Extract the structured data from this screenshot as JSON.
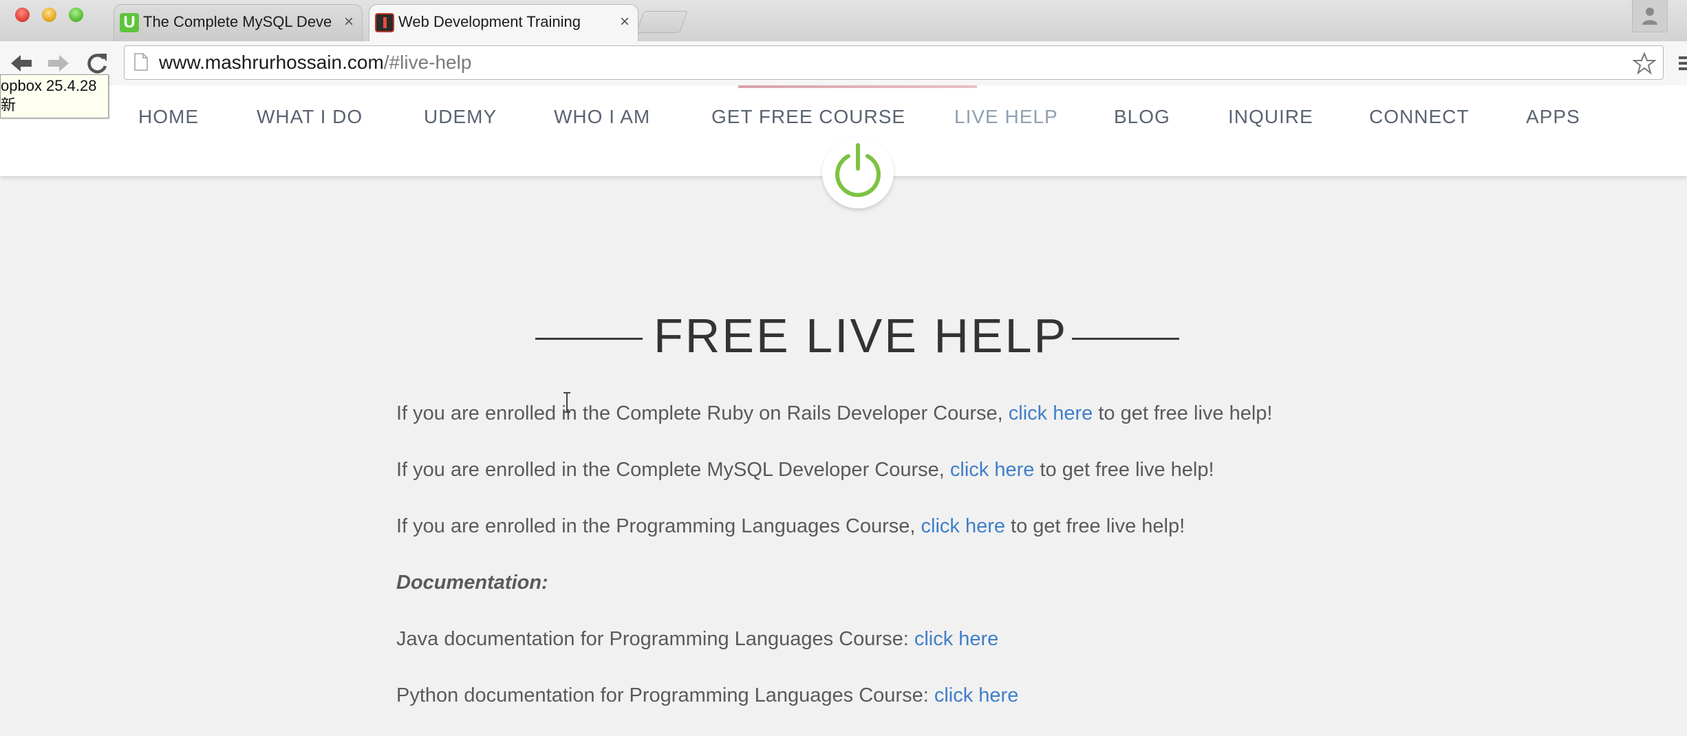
{
  "browser": {
    "tabs": [
      {
        "title": "The Complete MySQL Deve",
        "favicon": "U",
        "active": false
      },
      {
        "title": "Web Development Training",
        "active": true
      }
    ],
    "close_glyph": "×",
    "url_host": "www.mashrurhossain.com",
    "url_path": "/#live-help"
  },
  "tooltip": {
    "line1": "opbox 25.4.28",
    "line2": "新"
  },
  "site_nav": {
    "items": [
      "HOME",
      "WHAT I DO",
      "UDEMY",
      "WHO I AM",
      "GET FREE COURSE",
      "LIVE HELP",
      "BLOG",
      "INQUIRE",
      "CONNECT",
      "APPS"
    ],
    "active_item": "LIVE HELP"
  },
  "content": {
    "heading": "FREE LIVE HELP",
    "lines": [
      {
        "before": "If you are enrolled in the Complete Ruby on Rails Developer Course, ",
        "link": "click here",
        "after": " to get free live help!"
      },
      {
        "before": "If you are enrolled in the Complete MySQL Developer Course, ",
        "link": "click here",
        "after": " to get free live help!"
      },
      {
        "before": "If you are enrolled in the Programming Languages Course, ",
        "link": "click here",
        "after": " to get free live help!"
      }
    ],
    "docs_heading": "Documentation:",
    "docs": [
      {
        "before": "Java documentation for Programming Languages Course: ",
        "link": "click here"
      },
      {
        "before": "Python documentation for Programming Languages Course: ",
        "link": "click here"
      }
    ]
  },
  "colors": {
    "link": "#3f7fc9",
    "power_icon": "#7dc242",
    "nav_text": "#5a6372",
    "nav_active": "#8fa0b2"
  }
}
